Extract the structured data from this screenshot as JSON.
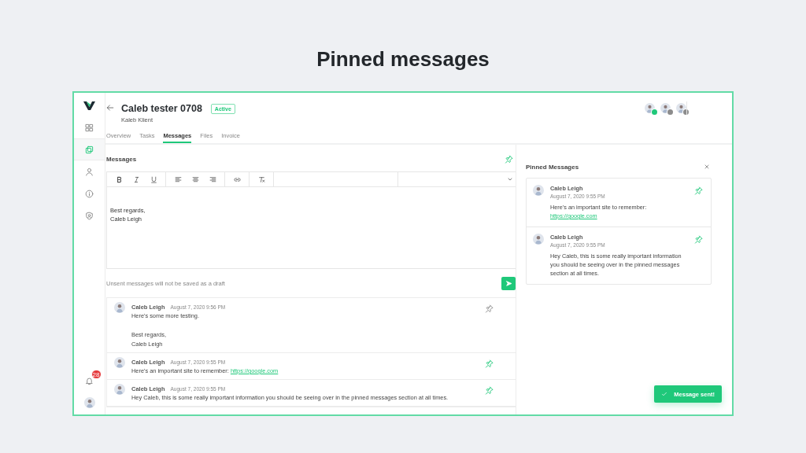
{
  "page": {
    "heading": "Pinned messages"
  },
  "sidebar": {
    "items": [
      {
        "selected": false
      },
      {
        "selected": true
      },
      {
        "selected": false
      },
      {
        "selected": false
      },
      {
        "selected": false
      }
    ],
    "notification_count": "28"
  },
  "header": {
    "title": "Caleb tester 0708",
    "status": "Active",
    "subtitle": "Kaleb Klient",
    "participants": [
      {
        "color": "#1fc87a"
      },
      {
        "color": "#8c8c8c"
      },
      {
        "color": "#8c8c8c"
      }
    ]
  },
  "tabs": [
    {
      "label": "Overview",
      "selected": false
    },
    {
      "label": "Tasks",
      "selected": false
    },
    {
      "label": "Messages",
      "selected": true
    },
    {
      "label": "Files",
      "selected": false
    },
    {
      "label": "Invoice",
      "selected": false
    }
  ],
  "composer": {
    "title": "Messages",
    "value": "Best regards,\nCaleb Leigh",
    "hint": "Unsent messages will not be saved as a draft"
  },
  "messages": [
    {
      "author": "Caleb Leigh",
      "time": "August 7, 2020 9:56 PM",
      "pinned": false,
      "text": "Here's some more testing.\n\nBest regards,\nCaleb Leigh"
    },
    {
      "author": "Caleb Leigh",
      "time": "August 7, 2020 9:55 PM",
      "pinned": true,
      "text": "Here's an important site to remember:",
      "link": "https://google.com"
    },
    {
      "author": "Caleb Leigh",
      "time": "August 7, 2020 9:55 PM",
      "pinned": true,
      "text": "Hey Caleb, this is some really important information you should be seeing over in the pinned messages section at all times."
    }
  ],
  "pinned_panel": {
    "title": "Pinned Messages",
    "items": [
      {
        "author": "Caleb Leigh",
        "time": "August 7, 2020 9:55 PM",
        "text": "Here's an important site to remember:",
        "link": "https://google.com"
      },
      {
        "author": "Caleb Leigh",
        "time": "August 7, 2020 9:55 PM",
        "text": "Hey Caleb, this is some really important information you should be seeing over in the pinned messages section at all times."
      }
    ]
  },
  "toast": {
    "text": "Message sent!"
  }
}
